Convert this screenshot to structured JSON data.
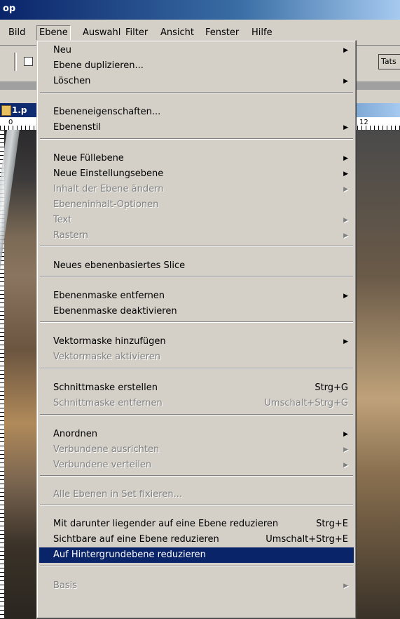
{
  "app": {
    "title_fragment": "op"
  },
  "menubar": {
    "items": [
      "Bild",
      "Ebene",
      "Auswahl",
      "Filter",
      "Ansicht",
      "Fenster",
      "Hilfe"
    ]
  },
  "optionsbar": {
    "button_label": "Tats"
  },
  "document": {
    "title_fragment": "1.p",
    "ruler_start": "0",
    "ruler_end": "12"
  },
  "menu": {
    "items": [
      {
        "label": "Neu",
        "submenu": true,
        "disabled": false
      },
      {
        "label": "Ebene duplizieren...",
        "disabled": false
      },
      {
        "label": "Löschen",
        "submenu": true,
        "disabled": false
      },
      {
        "label": "Ebeneneigenschaften...",
        "disabled": false
      },
      {
        "label": "Ebenenstil",
        "submenu": true,
        "disabled": false
      },
      {
        "label": "Neue Füllebene",
        "submenu": true,
        "disabled": false
      },
      {
        "label": "Neue Einstellungsebene",
        "submenu": true,
        "disabled": false
      },
      {
        "label": "Inhalt der Ebene ändern",
        "submenu": true,
        "disabled": true
      },
      {
        "label": "Ebeneninhalt-Optionen",
        "disabled": true
      },
      {
        "label": "Text",
        "submenu": true,
        "disabled": true
      },
      {
        "label": "Rastern",
        "submenu": true,
        "disabled": true
      },
      {
        "label": "Neues ebenenbasiertes Slice",
        "disabled": false
      },
      {
        "label": "Ebenenmaske entfernen",
        "submenu": true,
        "disabled": false
      },
      {
        "label": "Ebenenmaske deaktivieren",
        "disabled": false
      },
      {
        "label": "Vektormaske hinzufügen",
        "submenu": true,
        "disabled": false
      },
      {
        "label": "Vektormaske aktivieren",
        "disabled": true
      },
      {
        "label": "Schnittmaske erstellen",
        "shortcut": "Strg+G",
        "disabled": false
      },
      {
        "label": "Schnittmaske entfernen",
        "shortcut": "Umschalt+Strg+G",
        "disabled": true
      },
      {
        "label": "Anordnen",
        "submenu": true,
        "disabled": false
      },
      {
        "label": "Verbundene ausrichten",
        "submenu": true,
        "disabled": true
      },
      {
        "label": "Verbundene verteilen",
        "submenu": true,
        "disabled": true
      },
      {
        "label": "Alle Ebenen in Set fixieren...",
        "disabled": true
      },
      {
        "label": "Mit darunter liegender auf eine Ebene reduzieren",
        "shortcut": "Strg+E",
        "disabled": false
      },
      {
        "label": "Sichtbare auf eine Ebene reduzieren",
        "shortcut": "Umschalt+Strg+E",
        "disabled": false
      },
      {
        "label": "Auf Hintergrundebene reduzieren",
        "disabled": false,
        "highlighted": true
      },
      {
        "label": "Basis",
        "submenu": true,
        "disabled": true
      }
    ]
  },
  "colors": {
    "highlight": "#0a246a",
    "menu_bg": "#d4d0c8",
    "disabled_text": "#808080"
  }
}
